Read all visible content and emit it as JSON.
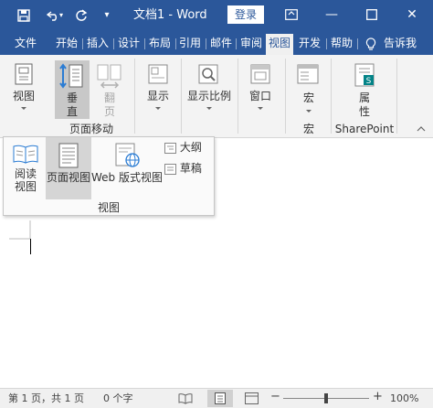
{
  "titlebar": {
    "title": "文档1 - Word",
    "login_label": "登录",
    "minimize_glyph": "—",
    "close_glyph": "✕"
  },
  "tabs": [
    {
      "label": "文件"
    },
    {
      "label": "开始"
    },
    {
      "label": "插入"
    },
    {
      "label": "设计"
    },
    {
      "label": "布局"
    },
    {
      "label": "引用"
    },
    {
      "label": "邮件"
    },
    {
      "label": "审阅"
    },
    {
      "label": "视图",
      "active": true
    },
    {
      "label": "开发"
    },
    {
      "label": "帮助"
    },
    {
      "label": "告诉我"
    }
  ],
  "ribbon": {
    "views_label": "视图",
    "vertical_label_1": "垂",
    "vertical_label_2": "直",
    "side_by_side_label_1": "翻",
    "side_by_side_label_2": "页",
    "page_movement_group": "页面移动",
    "show_label": "显示",
    "zoom_label": "显示比例",
    "window_label": "窗口",
    "macros_label": "宏",
    "macros_group": "宏",
    "properties_label_1": "属",
    "properties_label_2": "性",
    "sharepoint_group": "SharePoint"
  },
  "views_popup": {
    "read_mode_1": "阅读",
    "read_mode_2": "视图",
    "print_layout": "页面视图",
    "web_layout": "Web 版式视图",
    "outline": "大纲",
    "draft": "草稿",
    "group_label": "视图"
  },
  "status": {
    "page_info": "第 1 页，共 1 页",
    "word_count": "0 个字",
    "zoom_out": "−",
    "zoom_in": "+",
    "zoom_level": "100%",
    "zoom_fraction": 0.5
  },
  "colors": {
    "brand_blue": "#2b579a",
    "ribbon_bg": "#f3f3f3",
    "active_view_bg": "#d5d5d5"
  }
}
